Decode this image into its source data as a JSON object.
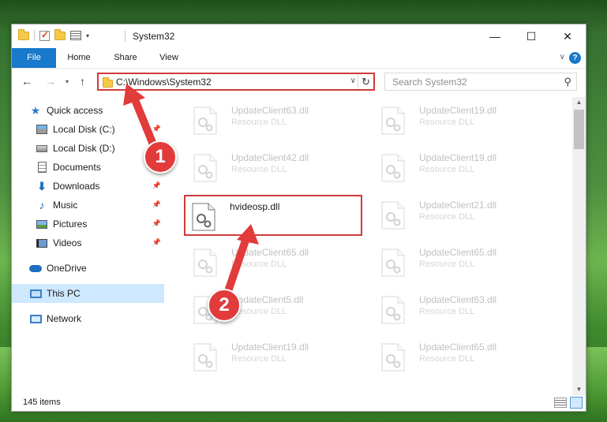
{
  "window": {
    "title": "System32",
    "controls": {
      "minimize": "—",
      "maximize": "☐",
      "close": "✕"
    }
  },
  "ribbon": {
    "tabs": [
      "File",
      "Home",
      "Share",
      "View"
    ],
    "help": "?"
  },
  "address": {
    "path": "C:\\Windows\\System32",
    "search_placeholder": "Search System32"
  },
  "sidebar": {
    "items": [
      {
        "label": "Quick access",
        "icon": "star-icon",
        "pinned": false
      },
      {
        "label": "Local Disk (C:)",
        "icon": "local-disk-c-icon",
        "pinned": true
      },
      {
        "label": "Local Disk (D:)",
        "icon": "local-disk-d-icon",
        "pinned": false
      },
      {
        "label": "Documents",
        "icon": "documents-icon",
        "pinned": true
      },
      {
        "label": "Downloads",
        "icon": "downloads-icon",
        "pinned": true
      },
      {
        "label": "Music",
        "icon": "music-icon",
        "pinned": true
      },
      {
        "label": "Pictures",
        "icon": "pictures-icon",
        "pinned": true
      },
      {
        "label": "Videos",
        "icon": "videos-icon",
        "pinned": true
      },
      {
        "label": "OneDrive",
        "icon": "onedrive-icon",
        "pinned": false
      },
      {
        "label": "This PC",
        "icon": "this-pc-icon",
        "pinned": false,
        "selected": true
      },
      {
        "label": "Network",
        "icon": "network-icon",
        "pinned": false
      }
    ]
  },
  "files": {
    "left_column": [
      {
        "name": "UpdateClient63.dll",
        "type": "Resource DLL",
        "faded": true
      },
      {
        "name": "UpdateClient42.dll",
        "type": "Resource DLL",
        "faded": true
      },
      {
        "name": "hvideosp.dll",
        "type": "",
        "faded": false,
        "highlight": true
      },
      {
        "name": "UpdateClient65.dll",
        "type": "Resource DLL",
        "faded": true
      },
      {
        "name": "UpdateClient5.dll",
        "type": "Resource DLL",
        "faded": true
      },
      {
        "name": "UpdateClient19.dll",
        "type": "Resource DLL",
        "faded": true
      }
    ],
    "right_column": [
      {
        "name": "UpdateClient19.dll",
        "type": "Resource DLL",
        "faded": true
      },
      {
        "name": "UpdateClient19.dll",
        "type": "Resource DLL",
        "faded": true
      },
      {
        "name": "UpdateClient21.dll",
        "type": "Resource DLL",
        "faded": true
      },
      {
        "name": "UpdateClient65.dll",
        "type": "Resource DLL",
        "faded": true
      },
      {
        "name": "UpdateClient63.dll",
        "type": "Resource DLL",
        "faded": true
      },
      {
        "name": "UpdateClient65.dll",
        "type": "Resource DLL",
        "faded": true
      }
    ]
  },
  "status": {
    "item_count": "145 items"
  },
  "annotations": {
    "step1": "1",
    "step2": "2",
    "color": "#e23b3b"
  }
}
